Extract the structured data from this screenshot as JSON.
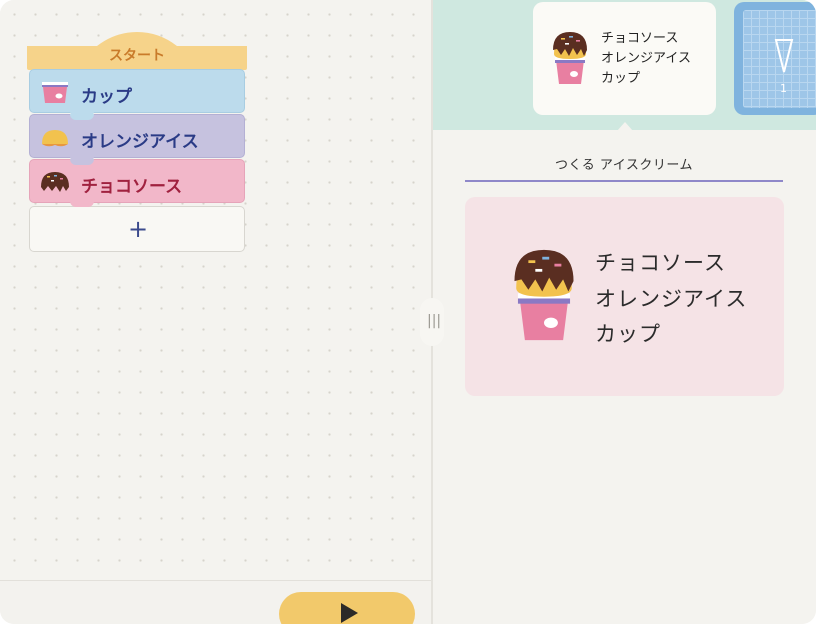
{
  "workspace": {
    "start_label": "スタート",
    "blocks": [
      {
        "label": "カップ",
        "icon": "cup-icon"
      },
      {
        "label": "オレンジアイス",
        "icon": "orange-ice-icon"
      },
      {
        "label": "チョコソース",
        "icon": "chocolate-sauce-icon"
      }
    ],
    "add_label": "+"
  },
  "run_button": {
    "icon": "play-icon"
  },
  "resize_handle": {
    "glyph": "|||"
  },
  "cards": {
    "recipe": {
      "lines": [
        "チョコソース",
        "オレンジアイス",
        "カップ"
      ]
    },
    "cone": {
      "number": "1"
    }
  },
  "result": {
    "heading": "つくる アイスクリーム",
    "lines": [
      "チョコソース",
      "オレンジアイス",
      "カップ"
    ]
  },
  "colors": {
    "cup_block": "#bcdbec",
    "orange_block": "#c6c2df",
    "choco_block": "#f2b7c9",
    "start_block": "#f6d38a",
    "run_button": "#f2c96b",
    "cards_strip": "#cfe8e0",
    "result_card": "#f5e3e6"
  }
}
